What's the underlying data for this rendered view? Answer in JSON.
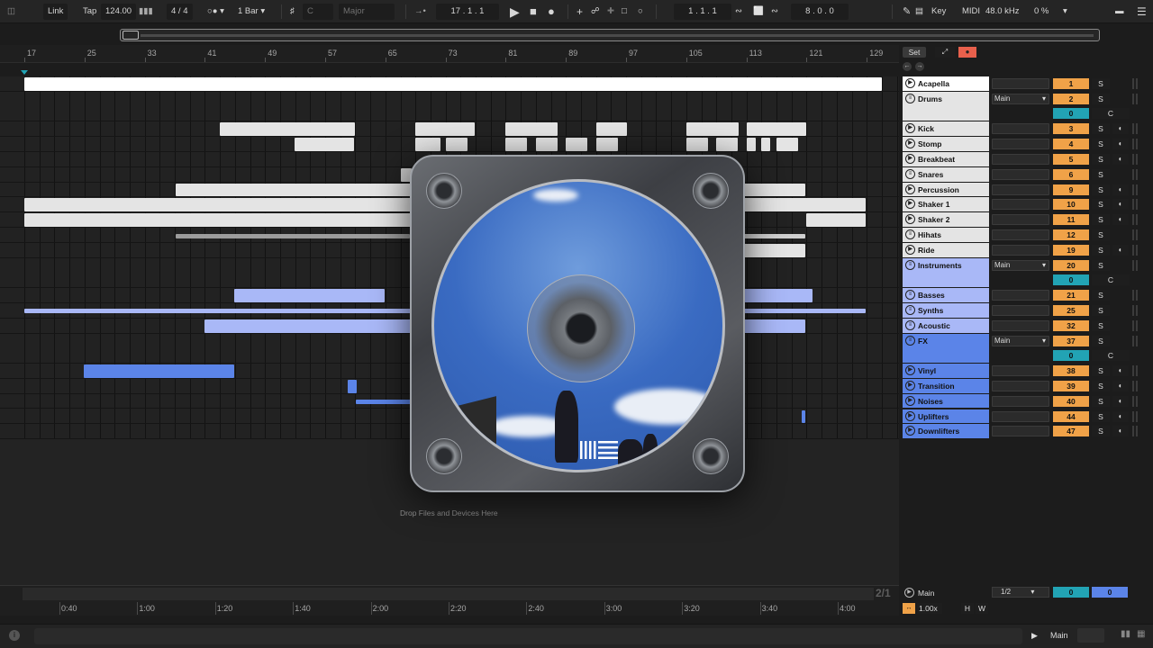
{
  "transport": {
    "link": "Link",
    "tap": "Tap",
    "tempo": "124.00",
    "signature": "4 / 4",
    "quantize": "1 Bar",
    "key_root": "C",
    "key_scale": "Major",
    "position": "17 .  1 .  1",
    "loop_start": "1 .  1 .  1",
    "loop_length": "8 .  0 .  0",
    "key_label": "Key",
    "midi_label": "MIDI",
    "sample_rate": "48.0 kHz",
    "cpu": "0 %"
  },
  "ruler": {
    "bars": [
      "17",
      "25",
      "33",
      "41",
      "49",
      "57",
      "65",
      "73",
      "81",
      "89",
      "97",
      "105",
      "113",
      "121",
      "129"
    ]
  },
  "set_controls": {
    "set_label": "Set"
  },
  "tracks": [
    {
      "name": "Acapella",
      "color": "#ffffff",
      "number": "1",
      "solo": "S",
      "type": "audio"
    },
    {
      "name": "Drums",
      "color": "#e4e4e4",
      "route": "Main",
      "number": "2",
      "solo": "S",
      "volume": "0",
      "cue": "C",
      "type": "group"
    },
    {
      "name": "Kick",
      "color": "#e4e4e4",
      "number": "3",
      "solo": "S",
      "type": "audio"
    },
    {
      "name": "Stomp",
      "color": "#e4e4e4",
      "number": "4",
      "solo": "S",
      "type": "audio"
    },
    {
      "name": "Breakbeat",
      "color": "#e4e4e4",
      "number": "5",
      "solo": "S",
      "type": "audio"
    },
    {
      "name": "Snares",
      "color": "#e4e4e4",
      "number": "6",
      "solo": "S",
      "type": "group-child"
    },
    {
      "name": "Percussion",
      "color": "#e4e4e4",
      "number": "9",
      "solo": "S",
      "type": "audio"
    },
    {
      "name": "Shaker 1",
      "color": "#e4e4e4",
      "number": "10",
      "solo": "S",
      "type": "audio"
    },
    {
      "name": "Shaker 2",
      "color": "#e4e4e4",
      "number": "11",
      "solo": "S",
      "type": "audio"
    },
    {
      "name": "Hihats",
      "color": "#e4e4e4",
      "number": "12",
      "solo": "S",
      "type": "group-child"
    },
    {
      "name": "Ride",
      "color": "#e4e4e4",
      "number": "19",
      "solo": "S",
      "type": "audio"
    },
    {
      "name": "Instruments",
      "color": "#a9b8f7",
      "route": "Main",
      "number": "20",
      "solo": "S",
      "volume": "0",
      "cue": "C",
      "type": "group"
    },
    {
      "name": "Basses",
      "color": "#a9b8f7",
      "number": "21",
      "solo": "S",
      "type": "group-child"
    },
    {
      "name": "Synths",
      "color": "#a9b8f7",
      "number": "25",
      "solo": "S",
      "type": "group-child"
    },
    {
      "name": "Acoustic",
      "color": "#a9b8f7",
      "number": "32",
      "solo": "S",
      "type": "group-child"
    },
    {
      "name": "FX",
      "color": "#5b84e8",
      "route": "Main",
      "number": "37",
      "solo": "S",
      "volume": "0",
      "cue": "C",
      "type": "group"
    },
    {
      "name": "Vinyl",
      "color": "#5b84e8",
      "number": "38",
      "solo": "S",
      "type": "audio"
    },
    {
      "name": "Transition",
      "color": "#5b84e8",
      "number": "39",
      "solo": "S",
      "type": "audio"
    },
    {
      "name": "Noises",
      "color": "#5b84e8",
      "number": "40",
      "solo": "S",
      "type": "audio"
    },
    {
      "name": "Uplifters",
      "color": "#5b84e8",
      "number": "44",
      "solo": "S",
      "type": "audio"
    },
    {
      "name": "Downlifters",
      "color": "#5b84e8",
      "number": "47",
      "solo": "S",
      "type": "audio"
    }
  ],
  "arrangement": {
    "drop_hint": "Drop Files and Devices Here"
  },
  "timeline": {
    "times": [
      "0:40",
      "1:00",
      "1:20",
      "1:40",
      "2:00",
      "2:20",
      "2:40",
      "3:00",
      "3:20",
      "3:40",
      "4:00"
    ],
    "zoom": "2/1"
  },
  "main_track": {
    "name": "Main",
    "quantize": "1/2",
    "volume": "0",
    "pan": "0",
    "speed": "1.00x",
    "h_label": "H",
    "w_label": "W"
  },
  "status": {
    "main_label": "Main"
  }
}
